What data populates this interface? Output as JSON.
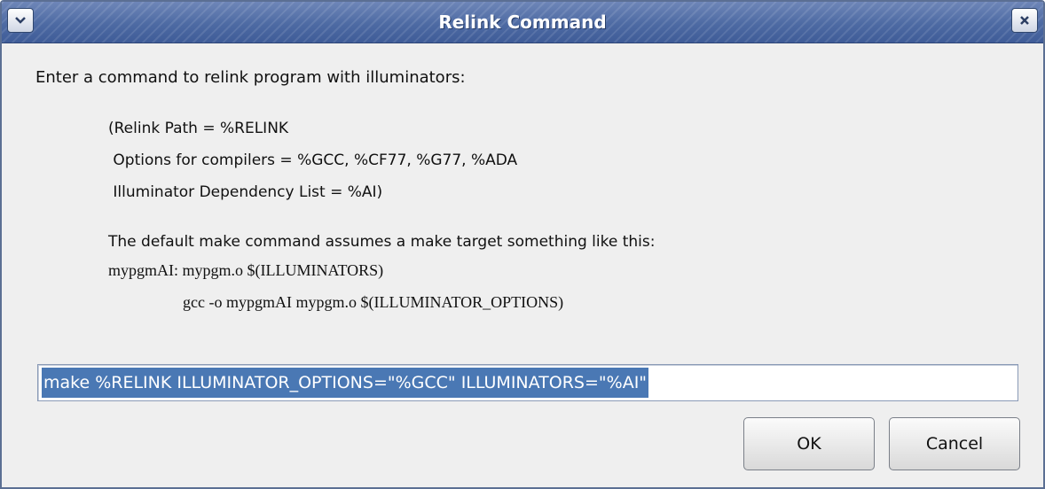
{
  "window": {
    "title": "Relink Command",
    "menu_icon": "chevron-down-icon",
    "close_icon": "close-icon",
    "accent": "#4d6aa3"
  },
  "dialog": {
    "prompt": "Enter a command to relink program with illuminators:",
    "info_lines": [
      "(Relink Path = %RELINK",
      " Options for compilers = %GCC, %CF77, %G77, %ADA",
      " Illuminator Dependency List = %AI)"
    ],
    "default_note": "The default make command assumes a make target something like this:",
    "example_lines": [
      "mypgmAI: mypgm.o $(ILLUMINATORS)",
      "gcc -o mypgmAI mypgm.o $(ILLUMINATOR_OPTIONS)"
    ],
    "command_value": "make %RELINK ILLUMINATOR_OPTIONS=\"%GCC\" ILLUMINATORS=\"%AI\"",
    "selection_color": "#4a78b4"
  },
  "buttons": {
    "ok_label": "OK",
    "cancel_label": "Cancel"
  }
}
